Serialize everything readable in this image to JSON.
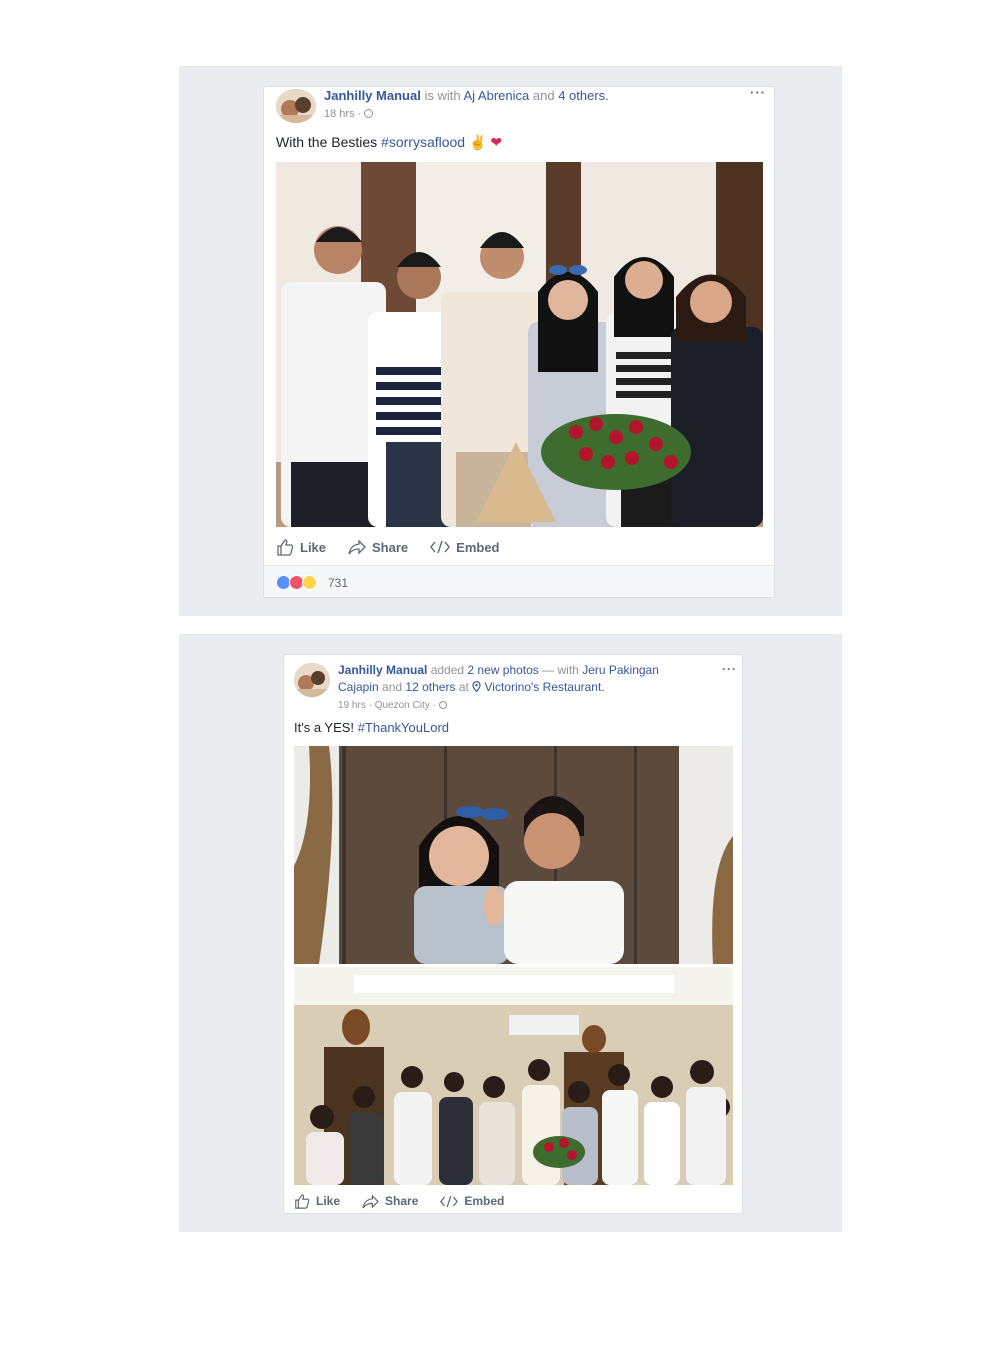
{
  "post1": {
    "author": "Janhilly Manual",
    "with_text": "is with",
    "tagged": "Aj Abrenica",
    "and_text": "and",
    "others": "4 others.",
    "time": "18 hrs",
    "separator": "·",
    "text": "With the Besties",
    "hashtag": "#sorrysaflood",
    "emoji": "✌",
    "heart": "❤",
    "more": "···",
    "actions": {
      "like": "Like",
      "share": "Share",
      "embed": "Embed"
    },
    "reaction_count": "731"
  },
  "post2": {
    "author": "Janhilly Manual",
    "added_text": "added",
    "photos_link": "2 new photos",
    "with_text": "— with",
    "tagged": "Jeru Pakingan Cajapin",
    "and_text": "and",
    "others": "12 others",
    "at_text": "at",
    "place": "Victorino's Restaurant.",
    "time": "19 hrs",
    "separator": "·",
    "location": "Quezon City",
    "separator2": "·",
    "text": "It's a YES!",
    "hashtag": "#ThankYouLord",
    "more": "···",
    "actions": {
      "like": "Like",
      "share": "Share",
      "embed": "Embed"
    }
  },
  "colors": {
    "link": "#365899",
    "panel": "#e9ebee",
    "like_blue": "#5890ff",
    "love_red": "#f25268",
    "wow_yellow": "#fcd54c"
  }
}
